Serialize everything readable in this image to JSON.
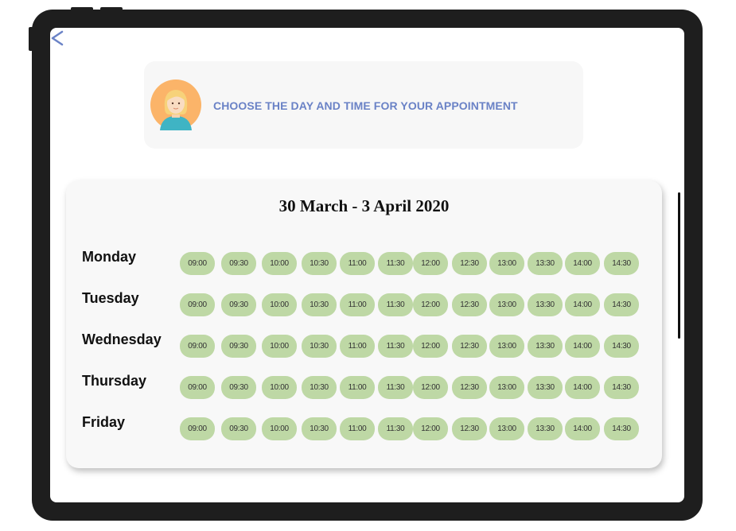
{
  "header": {
    "title": "CHOOSE THE DAY AND TIME FOR YOUR APPOINTMENT"
  },
  "schedule": {
    "week_range": "30 March - 3 April 2020",
    "days": [
      {
        "label": "Monday",
        "slots": [
          "09:00",
          "09:30",
          "10:00",
          "10:30",
          "11:00",
          "11:30",
          "12:00",
          "12:30",
          "13:00",
          "13:30",
          "14:00",
          "14:30"
        ]
      },
      {
        "label": "Tuesday",
        "slots": [
          "09:00",
          "09:30",
          "10:00",
          "10:30",
          "11:00",
          "11:30",
          "12:00",
          "12:30",
          "13:00",
          "13:30",
          "14:00",
          "14:30"
        ]
      },
      {
        "label": "Wednesday",
        "slots": [
          "09:00",
          "09:30",
          "10:00",
          "10:30",
          "11:00",
          "11:30",
          "12:00",
          "12:30",
          "13:00",
          "13:30",
          "14:00",
          "14:30"
        ]
      },
      {
        "label": "Thursday",
        "slots": [
          "09:00",
          "09:30",
          "10:00",
          "10:30",
          "11:00",
          "11:30",
          "12:00",
          "12:30",
          "13:00",
          "13:30",
          "14:00",
          "14:30"
        ]
      },
      {
        "label": "Friday",
        "slots": [
          "09:00",
          "09:30",
          "10:00",
          "10:30",
          "11:00",
          "11:30",
          "12:00",
          "12:30",
          "13:00",
          "13:30",
          "14:00",
          "14:30"
        ]
      }
    ]
  },
  "icons": {
    "back": "chevron-left-icon",
    "avatar": "user-avatar-woman"
  },
  "colors": {
    "accent": "#6a82c6",
    "slot_bg": "#bed8a5",
    "frame": "#1e1e1e"
  }
}
